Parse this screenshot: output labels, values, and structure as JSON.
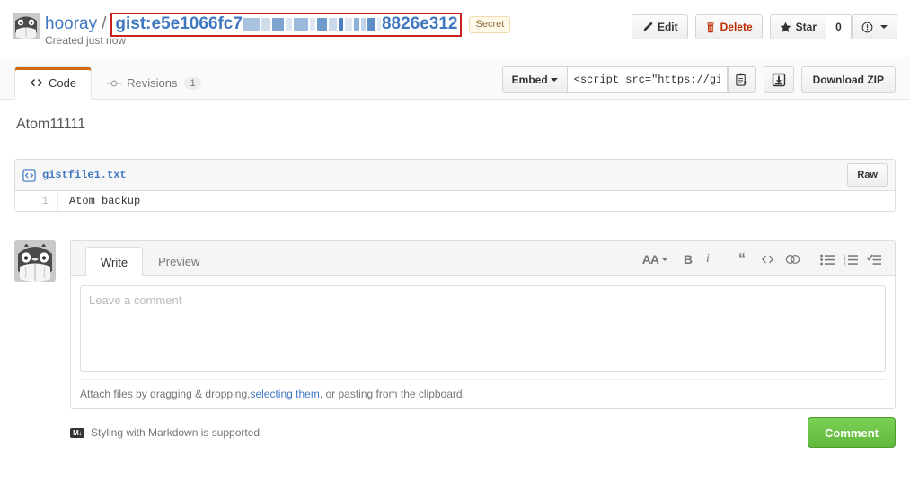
{
  "header": {
    "owner": "hooray",
    "separator": "/",
    "gist_prefix": "gist:",
    "gist_id_visible_start": "e5e1066fc7",
    "gist_id_visible_end": "8826e312",
    "secret_badge": "Secret",
    "created_text": "Created just now",
    "redaction_highlight_color": "#cc1f1f",
    "link_color": "#4078c0"
  },
  "actions": {
    "edit_label": "Edit",
    "delete_label": "Delete",
    "star_label": "Star",
    "star_count": "0",
    "delete_color": "#bd2c00"
  },
  "tabs": {
    "code_label": "Code",
    "revisions_label": "Revisions",
    "revisions_count": "1",
    "active_tab": "Code",
    "active_accent_color": "#d26911"
  },
  "embed": {
    "select_label": "Embed",
    "embed_value": "<script src=\"https://gist",
    "embed_placeholder": "<script src=\"https://gist",
    "download_zip_label": "Download ZIP"
  },
  "description": "Atom11111",
  "file": {
    "name": "gistfile1.txt",
    "raw_label": "Raw",
    "lines": [
      {
        "number": "1",
        "code": "Atom backup"
      }
    ]
  },
  "comment_form": {
    "write_tab": "Write",
    "preview_tab": "Preview",
    "active_tab": "Write",
    "textarea_value": "",
    "textarea_placeholder": "Leave a comment",
    "attach_text_before": "Attach files by dragging & dropping, ",
    "attach_link": "selecting them",
    "attach_text_after": ", or pasting from the clipboard.",
    "markdown_note": "Styling with Markdown is supported",
    "markdown_icon_text": "M",
    "submit_label": "Comment",
    "submit_color": "#6cc644",
    "toolbar": [
      "text-size-icon",
      "bold-icon",
      "italic-icon",
      "quote-icon",
      "code-icon",
      "link-icon",
      "unordered-list-icon",
      "ordered-list-icon",
      "task-list-icon"
    ]
  }
}
